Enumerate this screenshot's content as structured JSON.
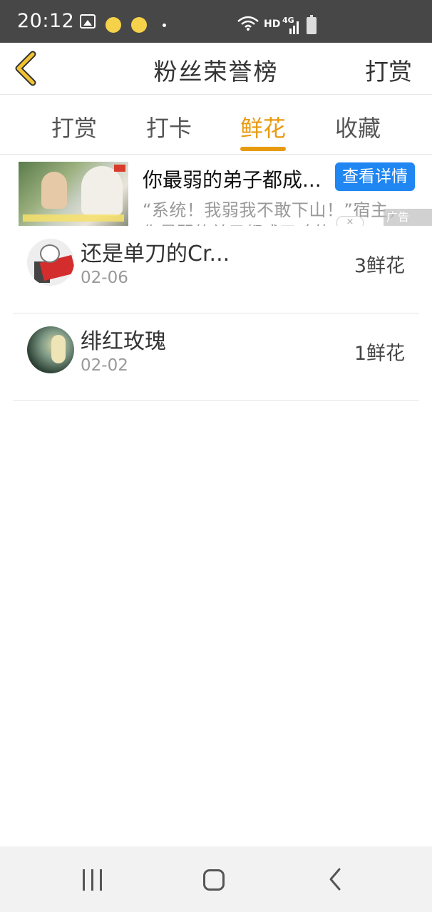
{
  "status_bar": {
    "time": "20:12",
    "network_hd": "HD",
    "network_gen": "4G"
  },
  "header": {
    "title": "粉丝荣誉榜",
    "right_action": "打赏"
  },
  "tabs": [
    {
      "label": "打赏",
      "active": false
    },
    {
      "label": "打卡",
      "active": false
    },
    {
      "label": "鲜花",
      "active": true
    },
    {
      "label": "收藏",
      "active": false
    }
  ],
  "ad": {
    "title": "你最弱的弟子都成...",
    "button": "查看详情",
    "desc_line1": "“系统！我弱我不敢下山！”宿主，",
    "desc_line2": "你最弱的弟子都成了魂的老祖！",
    "tag": "广告",
    "close": "×"
  },
  "fans": [
    {
      "name": "还是单刀的Cr...",
      "date": "02-06",
      "amount": "3鲜花"
    },
    {
      "name": "绯红玫瑰",
      "date": "02-02",
      "amount": "1鲜花"
    }
  ],
  "colors": {
    "accent": "#e89a0f",
    "ad_button": "#1f86f2",
    "status_bar": "#474747"
  }
}
